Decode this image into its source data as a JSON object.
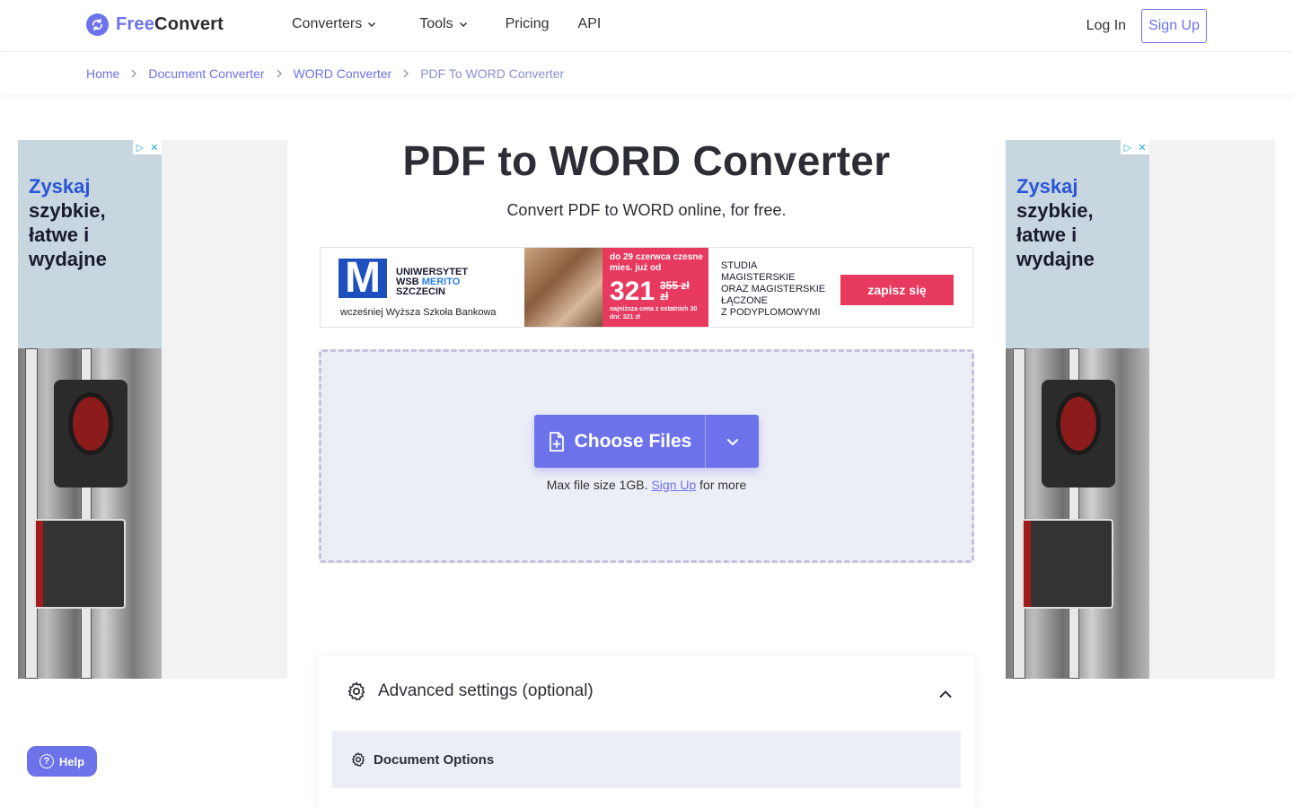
{
  "header": {
    "logo_free": "Free",
    "logo_convert": "Convert",
    "nav": {
      "converters": "Converters",
      "tools": "Tools",
      "pricing": "Pricing",
      "api": "API"
    },
    "login": "Log In",
    "signup": "Sign Up"
  },
  "breadcrumb": [
    "Home",
    "Document Converter",
    "WORD Converter",
    "PDF To WORD Converter"
  ],
  "side_ad": {
    "line1": "Zyskaj",
    "line2": "szybkie,",
    "line3": "łatwe i",
    "line4": "wydajne"
  },
  "page": {
    "title": "PDF to WORD Converter",
    "subtitle": "Convert PDF to WORD online, for free."
  },
  "banner": {
    "m": "M",
    "uni1": "UNIWERSYTET",
    "uni2a": "WSB",
    "uni2b": "MERITO",
    "uni3": "SZCZECIN",
    "prev": "wcześniej Wyższa Szkoła Bankowa",
    "price_top": "do 29 czerwca czesne mies. już od",
    "price_big": "321",
    "price_old": "355 zł",
    "price_unit": "zł",
    "price_note": "najniższa cena z ostatnich 30 dni: 321 zł",
    "studia": [
      "STUDIA",
      "MAGISTERSKIE",
      "ORAZ MAGISTERSKIE",
      "ŁĄCZONE",
      "Z PODYPLOMOWYMI"
    ],
    "cta": "zapisz się"
  },
  "upload": {
    "choose_label": "Choose Files",
    "max_prefix": "Max file size 1GB.",
    "max_link": "Sign Up",
    "max_suffix": "for more"
  },
  "advanced": {
    "title": "Advanced settings (optional)",
    "document_options": "Document Options"
  },
  "help": {
    "label": "Help"
  },
  "colors": {
    "accent": "#6c72ea",
    "ad_pink": "#e8395f",
    "dropzone_bg": "#eceef6"
  }
}
